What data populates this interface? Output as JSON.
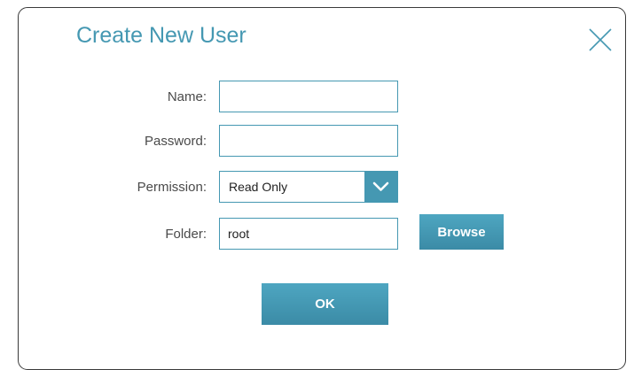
{
  "dialog": {
    "title": "Create New User",
    "close_icon": "close-icon"
  },
  "form": {
    "name": {
      "label": "Name:",
      "value": ""
    },
    "password": {
      "label": "Password:",
      "value": ""
    },
    "permission": {
      "label": "Permission:",
      "selected": "Read Only"
    },
    "folder": {
      "label": "Folder:",
      "value": "root"
    },
    "browse_label": "Browse",
    "ok_label": "OK"
  },
  "colors": {
    "accent": "#4598b2",
    "label_text": "#4a4a4a"
  }
}
